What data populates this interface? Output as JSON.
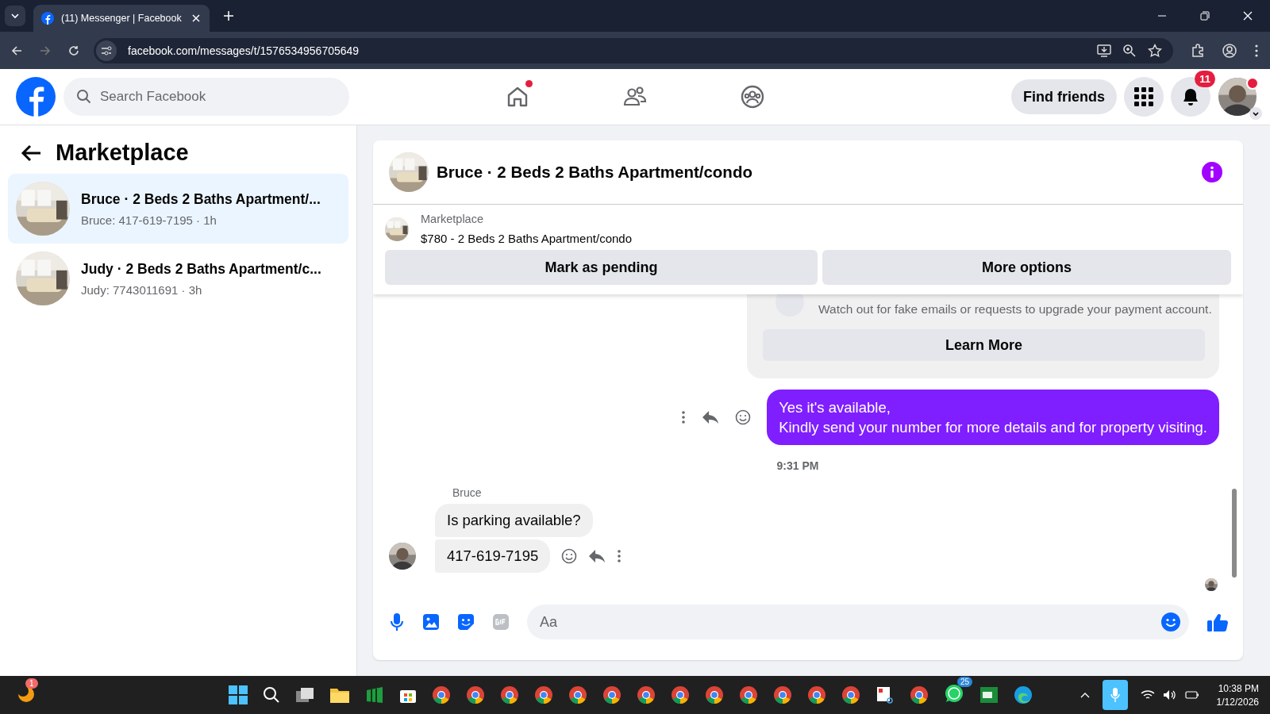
{
  "browser": {
    "tab_title": "(11) Messenger | Facebook",
    "url": "facebook.com/messages/t/1576534956705649"
  },
  "header": {
    "search": {
      "placeholder": "Search Facebook"
    },
    "nav": [
      {
        "kind": "home",
        "dot": true
      },
      {
        "kind": "friends",
        "dot": false
      },
      {
        "kind": "groups",
        "dot": false
      }
    ],
    "find_friends": "Find friends",
    "notification_count": "11",
    "profile_dot": true
  },
  "sidebar": {
    "title": "Marketplace",
    "conversations": [
      {
        "name": "Bruce · 2 Beds 2 Baths Apartment/...",
        "preview": "Bruce: 417-619-7195 · 1h",
        "selected": true
      },
      {
        "name": "Judy · 2 Beds 2 Baths Apartment/c...",
        "preview": "Judy: 7743011691 · 3h",
        "selected": false
      }
    ]
  },
  "chat": {
    "title": "Bruce · 2 Beds 2 Baths Apartment/condo",
    "listing": {
      "label": "Marketplace",
      "title": "$780 - 2 Beds 2 Baths Apartment/condo",
      "buttons": [
        "Mark as pending",
        "More options"
      ]
    },
    "notice": {
      "text": "Watch out for fake emails or requests to upgrade your payment account.",
      "button": "Learn More"
    },
    "outgoing": "Yes it's available,\nKindly send your number for more details and for property visiting.",
    "timestamp": "9:31 PM",
    "sender": "Bruce",
    "incoming": [
      "Is parking available?",
      "417-619-7195"
    ],
    "composer": {
      "placeholder": "Aa"
    }
  },
  "taskbar": {
    "app_badge": "1",
    "whatsapp_badge": "25",
    "time": "10:38 PM",
    "date": "1/12/2026"
  }
}
